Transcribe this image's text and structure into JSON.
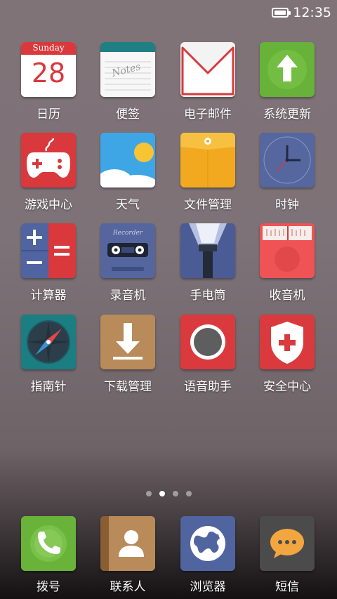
{
  "status_bar": {
    "time": "12:35"
  },
  "calendar": {
    "day_name": "Sunday",
    "date": "28"
  },
  "notes_text": "Notes",
  "recorder_text": "Recorder",
  "apps": [
    {
      "label": "日历",
      "icon": "calendar-icon"
    },
    {
      "label": "便签",
      "icon": "notes-icon"
    },
    {
      "label": "电子邮件",
      "icon": "email-icon"
    },
    {
      "label": "系统更新",
      "icon": "system-update-icon"
    },
    {
      "label": "游戏中心",
      "icon": "game-center-icon"
    },
    {
      "label": "天气",
      "icon": "weather-icon"
    },
    {
      "label": "文件管理",
      "icon": "file-manager-icon"
    },
    {
      "label": "时钟",
      "icon": "clock-icon"
    },
    {
      "label": "计算器",
      "icon": "calculator-icon"
    },
    {
      "label": "录音机",
      "icon": "recorder-icon"
    },
    {
      "label": "手电筒",
      "icon": "flashlight-icon"
    },
    {
      "label": "收音机",
      "icon": "radio-icon"
    },
    {
      "label": "指南针",
      "icon": "compass-icon"
    },
    {
      "label": "下载管理",
      "icon": "download-manager-icon"
    },
    {
      "label": "语音助手",
      "icon": "voice-assistant-icon"
    },
    {
      "label": "安全中心",
      "icon": "security-center-icon"
    }
  ],
  "pager": {
    "page_count": 4,
    "active_page": 2
  },
  "dock": [
    {
      "label": "拨号",
      "icon": "phone-icon"
    },
    {
      "label": "联系人",
      "icon": "contacts-icon"
    },
    {
      "label": "浏览器",
      "icon": "browser-icon"
    },
    {
      "label": "短信",
      "icon": "messages-icon"
    }
  ]
}
